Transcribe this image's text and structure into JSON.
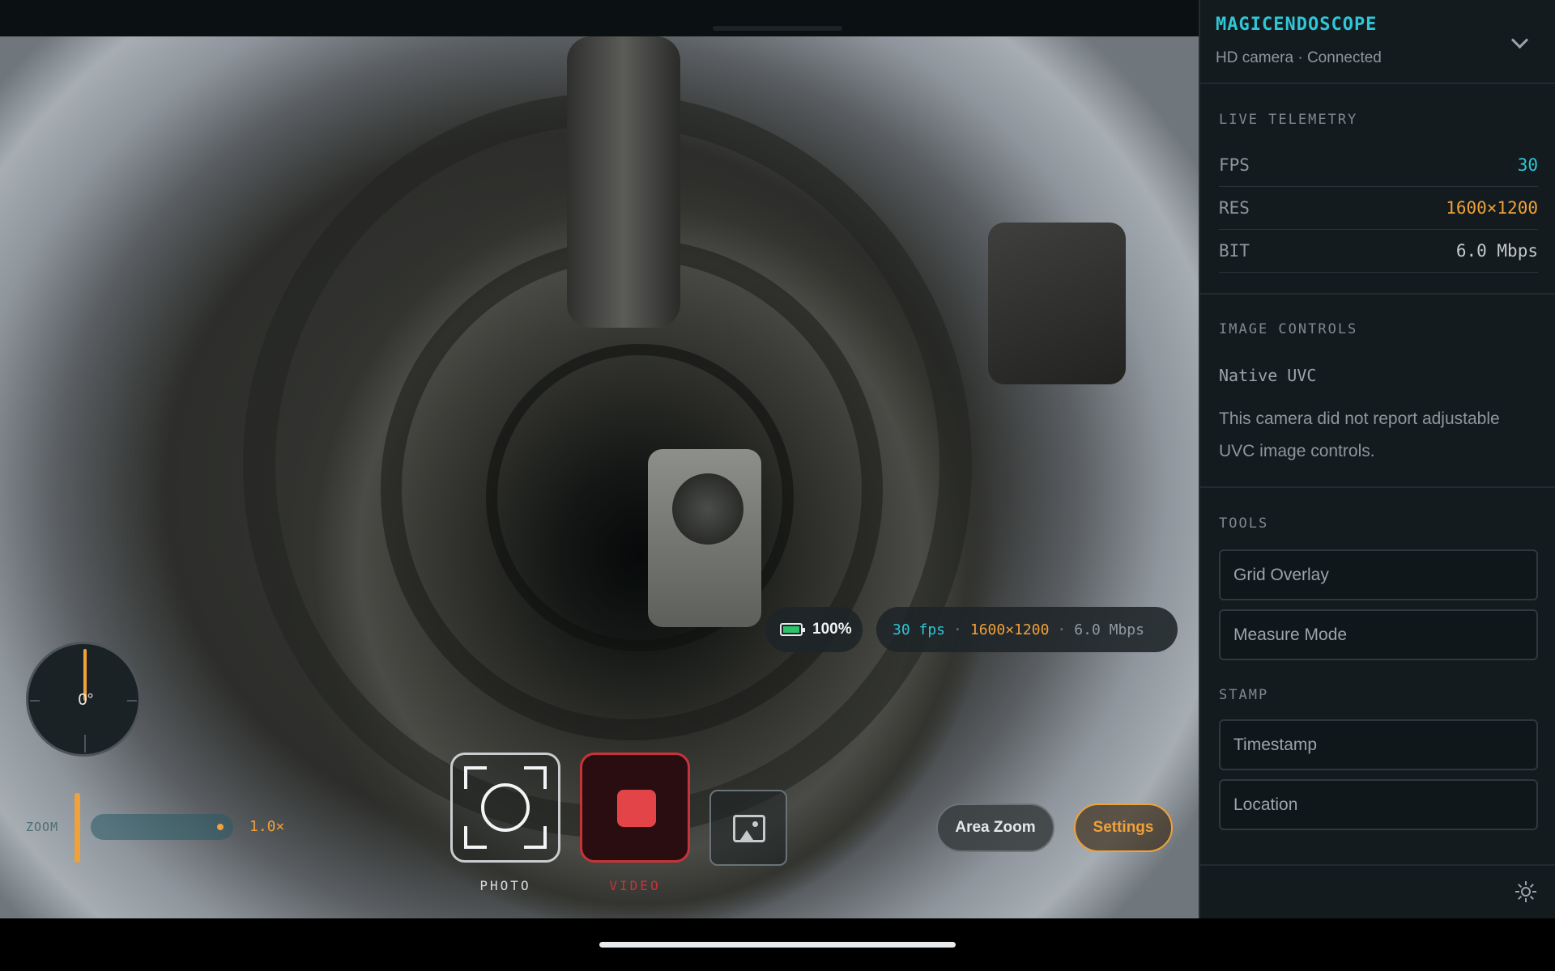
{
  "app": {
    "title": "MAGICENDOSCOPE",
    "device_status": "HD camera · Connected"
  },
  "hud": {
    "battery": "100%",
    "stats": {
      "fps": "30 fps",
      "resolution": "1600×1200",
      "bitrate": "6.0 Mbps"
    },
    "level_dial": {
      "value": "0°",
      "angle_degrees": 0
    },
    "zoom": {
      "label": "ZOOM",
      "value": "1.0×"
    },
    "capture": {
      "photo_label": "PHOTO",
      "video_label": "VIDEO"
    },
    "buttons": {
      "area_zoom": "Area Zoom",
      "settings": "Settings"
    }
  },
  "panel": {
    "telemetry": {
      "title": "LIVE TELEMETRY",
      "rows": [
        {
          "key": "FPS",
          "value": "30"
        },
        {
          "key": "RES",
          "value": "1600×1200"
        },
        {
          "key": "BIT",
          "value": "6.0 Mbps"
        }
      ]
    },
    "image_controls": {
      "title": "IMAGE CONTROLS",
      "mode": "Native UVC",
      "note": "This camera did not report adjustable UVC image controls."
    },
    "tools": {
      "title": "TOOLS",
      "items": [
        "Grid Overlay",
        "Measure Mode"
      ]
    },
    "stamp": {
      "title": "STAMP",
      "items": [
        "Timestamp",
        "Location"
      ]
    }
  },
  "colors": {
    "accent_cyan": "#2fc6d6",
    "accent_orange": "#f0a13a",
    "record_red": "#e24448",
    "panel_bg": "#141b1f"
  },
  "icons": [
    "battery-icon",
    "photo-capture-icon",
    "record-stop-icon",
    "gallery-icon",
    "chevron-down-icon",
    "brightness-icon"
  ]
}
